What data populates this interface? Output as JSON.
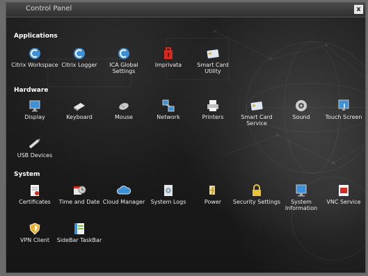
{
  "window": {
    "title": "Control Panel",
    "close_label": "x"
  },
  "sections": {
    "applications": "Applications",
    "hardware": "Hardware",
    "system": "System"
  },
  "applications": {
    "citrix_workspace": "Citrix Workspace",
    "citrix_logger": "Citrix Logger",
    "ica_global_settings": "ICA Global Settings",
    "imprivata": "Imprivata",
    "smart_card_utility": "Smart Card Utility"
  },
  "hardware": {
    "display": "Display",
    "keyboard": "Keyboard",
    "mouse": "Mouse",
    "network": "Network",
    "printers": "Printers",
    "smart_card_service": "Smart Card Service",
    "sound": "Sound",
    "touch_screen": "Touch Screen",
    "usb_devices": "USB Devices"
  },
  "system": {
    "certificates": "Certificates",
    "time_and_date": "Time and Date",
    "cloud_manager": "Cloud Manager",
    "system_logs": "System Logs",
    "power": "Power",
    "security_settings": "Security Settings",
    "system_information": "System Information",
    "vnc_service": "VNC Service",
    "vpn_client": "VPN Client",
    "sidebar_taskbar": "SideBar TaskBar"
  },
  "icons": {
    "citrix_workspace": "citrix-workspace-icon",
    "citrix_logger": "citrix-logger-icon",
    "ica_global_settings": "ica-settings-icon",
    "imprivata": "imprivata-icon",
    "smart_card_utility": "smart-card-icon",
    "display": "display-icon",
    "keyboard": "keyboard-icon",
    "mouse": "mouse-icon",
    "network": "network-icon",
    "printers": "printer-icon",
    "smart_card_service": "smart-card-icon",
    "sound": "sound-icon",
    "touch_screen": "touch-screen-icon",
    "usb_devices": "usb-icon",
    "certificates": "certificate-icon",
    "time_and_date": "clock-icon",
    "cloud_manager": "cloud-icon",
    "system_logs": "log-icon",
    "power": "power-icon",
    "security_settings": "lock-icon",
    "system_information": "info-icon",
    "vnc_service": "vnc-icon",
    "vpn_client": "shield-icon",
    "sidebar_taskbar": "sidebar-icon"
  },
  "colors": {
    "background": "#1a1a1a",
    "titlebar": "#3a3a3a",
    "citrix_blue": "#3d8fd6",
    "imprivata_red": "#d42a1f",
    "text": "#ededed"
  }
}
